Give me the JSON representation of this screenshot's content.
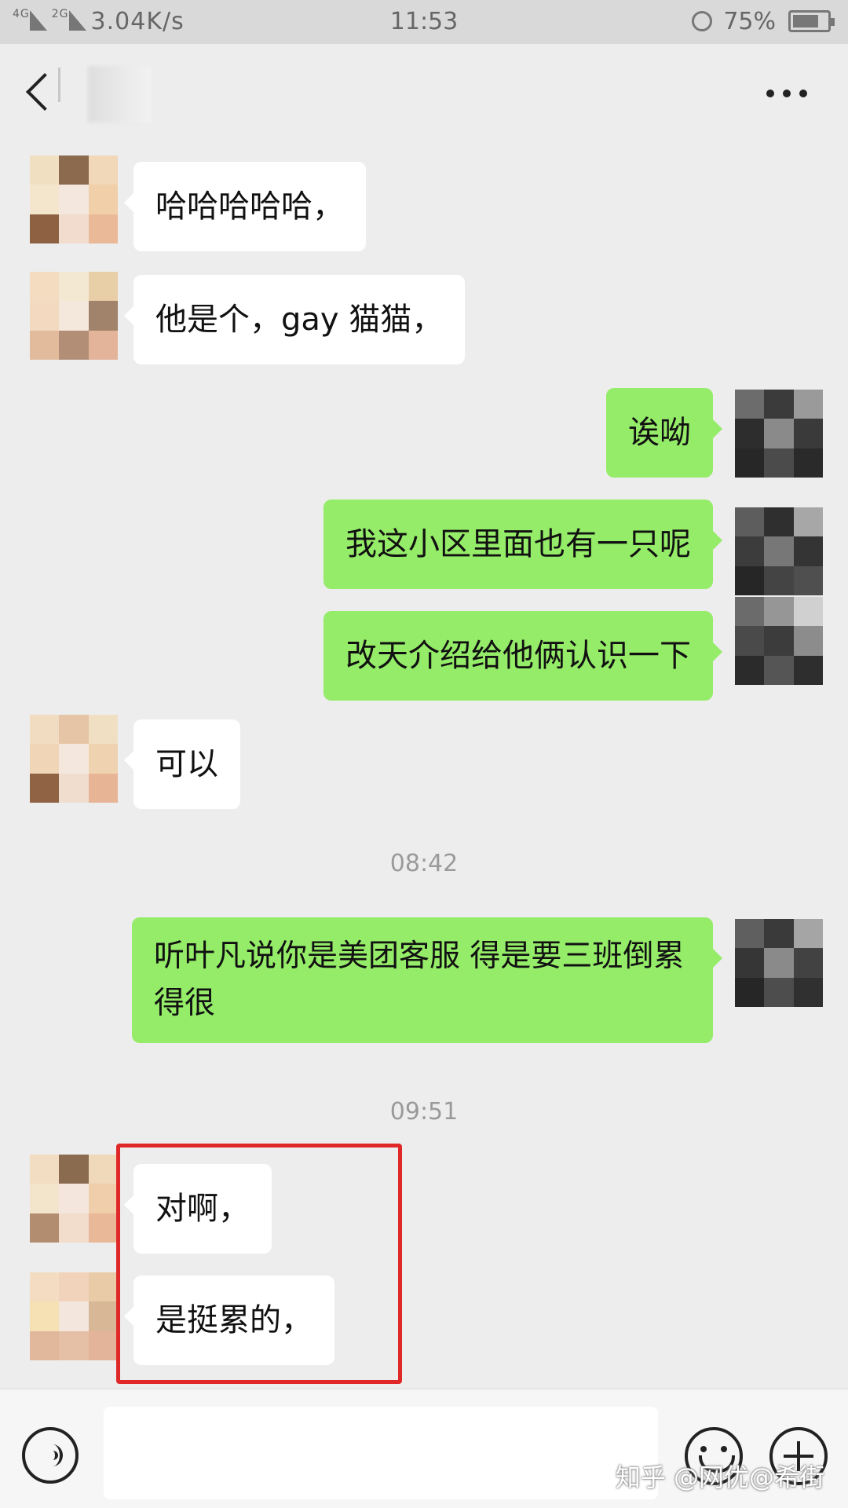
{
  "status_bar": {
    "signal": "4G",
    "signal2": "2G",
    "speed": "3.04K/s",
    "time": "11:53",
    "battery": "75%",
    "battery_level": 0.75
  },
  "nav": {
    "title": ""
  },
  "messages": [
    {
      "side": "in",
      "text": "哈哈哈哈哈，"
    },
    {
      "side": "in",
      "text": "他是个，gay 猫猫，"
    },
    {
      "side": "out",
      "text": "诶呦"
    },
    {
      "side": "out",
      "text": "我这小区里面也有一只呢"
    },
    {
      "side": "out",
      "text": "改天介绍给他俩认识一下"
    },
    {
      "side": "in",
      "text": "可以"
    },
    {
      "side": "out",
      "text": "听叶凡说你是美团客服 得是要三班倒累得很"
    },
    {
      "side": "in",
      "text": "对啊，"
    },
    {
      "side": "in",
      "text": "是挺累的，"
    }
  ],
  "timestamps": [
    "08:42",
    "09:51"
  ],
  "input": {
    "placeholder": ""
  },
  "watermark": "知乎 @网优@希街",
  "colors": {
    "incoming_bubble": "#ffffff",
    "outgoing_bubble": "#95ec69",
    "highlight": "#e02828",
    "background": "#ededed"
  }
}
